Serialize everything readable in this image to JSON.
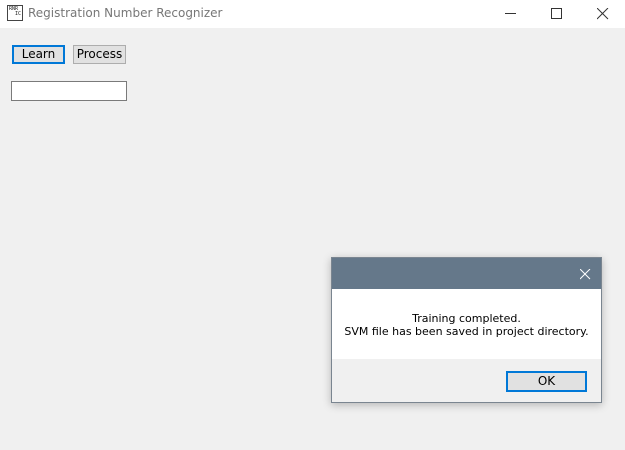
{
  "window": {
    "title": "Registration Number Recognizer",
    "icon_text": [
      "RNR",
      "IC"
    ],
    "minimize_icon": "minimize-icon",
    "maximize_icon": "maximize-icon",
    "close_icon": "close-icon"
  },
  "toolbar": {
    "learn_label": "Learn",
    "process_label": "Process"
  },
  "input": {
    "value": ""
  },
  "dialog": {
    "message_line1": "Training completed.",
    "message_line2": "SVM file has been saved in project directory.",
    "ok_label": "OK",
    "close_icon": "close-icon",
    "titlebar_color": "#65788a"
  },
  "colors": {
    "accent": "#0078d7",
    "window_bg": "#f0f0f0"
  }
}
